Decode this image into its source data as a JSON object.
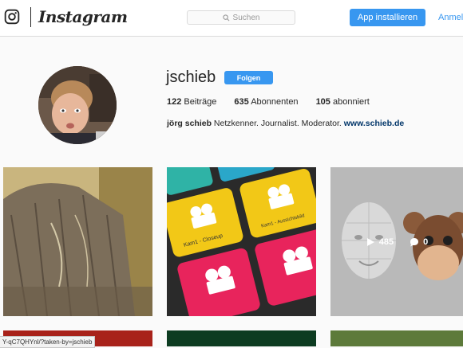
{
  "header": {
    "wordmark": "Instagram",
    "search_placeholder": "Suchen",
    "app_button": "App installieren",
    "login_link": "Anmelden"
  },
  "profile": {
    "username": "jschieb",
    "follow_button": "Folgen",
    "stats": {
      "posts_count": "122",
      "posts_label": "Beiträge",
      "followers_count": "635",
      "followers_label": "Abonnenten",
      "following_count": "105",
      "following_label": "abonniert"
    },
    "bio_name": "jörg schieb",
    "bio_text": " Netzkenner. Journalist. Moderator. ",
    "bio_link": "www.schieb.de"
  },
  "posts": [
    {
      "kind": "photo",
      "subject": "tree-bark"
    },
    {
      "kind": "photo",
      "subject": "camera-buttons",
      "labels": [
        "Kam1 - Closeup",
        "Kam1 - Aussichtsbild"
      ]
    },
    {
      "kind": "photo",
      "subject": "animoji",
      "hover_likes": "485",
      "hover_comments": "0"
    }
  ],
  "status_bar": {
    "url": "Y-qC7QHYnl/?taken-by=jschieb"
  },
  "colors": {
    "accent": "#3897f0",
    "link": "#003569",
    "border": "#dbdbdb"
  }
}
